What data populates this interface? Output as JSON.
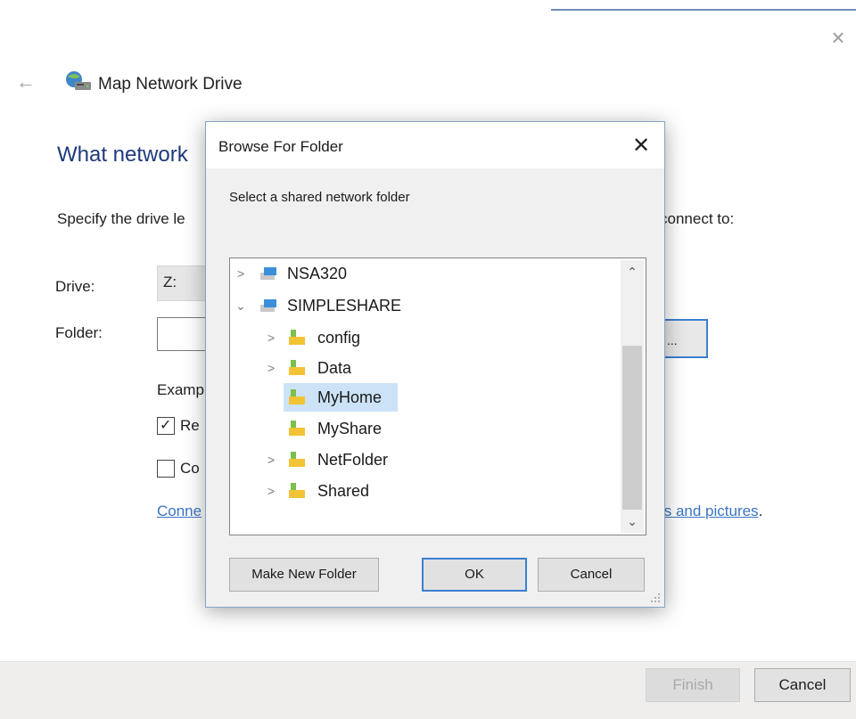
{
  "wizard": {
    "title": "Map Network Drive",
    "heading": "What network",
    "instruction_visible_left": "Specify the drive le",
    "instruction_visible_right": "connect to:",
    "drive_label": "Drive:",
    "drive_value": "Z:",
    "folder_label": "Folder:",
    "folder_value": "",
    "browse_label": "...",
    "example_partial": "Examp",
    "reconnect_partial": "Re",
    "reconnect_checked": true,
    "credentials_partial": "Co",
    "credentials_checked": false,
    "link_left_partial": "Conne",
    "link_right_partial": "ts and pictures",
    "link_right_dot": ".",
    "finish_label": "Finish",
    "cancel_label": "Cancel",
    "close_glyph": "×",
    "back_glyph": "←"
  },
  "browse_dialog": {
    "title": "Browse For Folder",
    "close_glyph": "✕",
    "prompt": "Select a shared network folder",
    "tree": [
      {
        "label": "NSA320",
        "expanded": false,
        "kind": "computer"
      },
      {
        "label": "SIMPLESHARE",
        "expanded": true,
        "kind": "computer"
      },
      {
        "label": "config",
        "expanded": false,
        "kind": "folder"
      },
      {
        "label": "Data",
        "expanded": false,
        "kind": "folder"
      },
      {
        "label": "MyHome",
        "selected": true,
        "kind": "folder"
      },
      {
        "label": "MyShare",
        "kind": "folder"
      },
      {
        "label": "NetFolder",
        "expanded": false,
        "kind": "folder"
      },
      {
        "label": "Shared",
        "expanded": false,
        "kind": "folder"
      }
    ],
    "new_folder_label": "Make New Folder",
    "ok_label": "OK",
    "cancel_label": "Cancel"
  },
  "colors": {
    "heading": "#1f3a7a",
    "link": "#3a74c4",
    "accent_border": "#3c7fd0",
    "selection": "#cce3f7",
    "folder": "#f2c335"
  }
}
